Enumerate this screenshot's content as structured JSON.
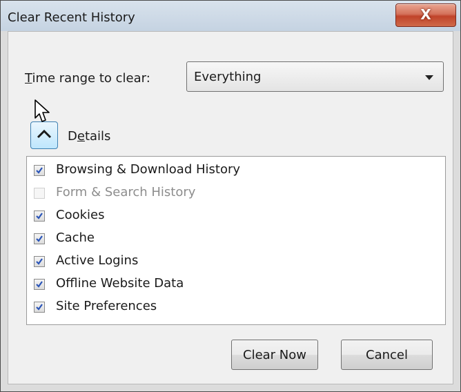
{
  "window": {
    "title": "Clear Recent History",
    "close_label": "X"
  },
  "time_range": {
    "label_prefix": "T",
    "label_rest": "ime range to clear:",
    "selected": "Everything"
  },
  "details": {
    "label_prefix": "D",
    "label_underline": "e",
    "label_rest": "tails",
    "expanded": true
  },
  "items": [
    {
      "label": "Browsing & Download History",
      "checked": true,
      "enabled": true
    },
    {
      "label": "Form & Search History",
      "checked": false,
      "enabled": false
    },
    {
      "label": "Cookies",
      "checked": true,
      "enabled": true
    },
    {
      "label": "Cache",
      "checked": true,
      "enabled": true
    },
    {
      "label": "Active Logins",
      "checked": true,
      "enabled": true
    },
    {
      "label": "Offline Website Data",
      "checked": true,
      "enabled": true
    },
    {
      "label": "Site Preferences",
      "checked": true,
      "enabled": true
    }
  ],
  "buttons": {
    "clear_now": "Clear Now",
    "cancel": "Cancel"
  },
  "colors": {
    "close_button": "#c9533a",
    "checkmark": "#2b55b8",
    "toggle_border": "#3c7fb1"
  },
  "icons": {
    "close": "close-icon",
    "chevron_up": "chevron-up-icon",
    "dropdown": "chevron-down-icon",
    "cursor": "mouse-cursor-icon",
    "checkmark": "checkmark-icon"
  }
}
